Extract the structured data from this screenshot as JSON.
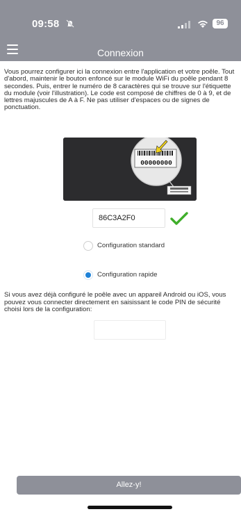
{
  "status_bar": {
    "time": "09:58",
    "battery": "96",
    "icons": [
      "bell-slash-icon",
      "signal-icon",
      "wifi-icon",
      "battery-icon"
    ]
  },
  "nav": {
    "title": "Connexion",
    "menu_icon": "menu-icon"
  },
  "intro_text": "Vous pourrez configurer ici la connexion entre l'application et votre poêle. Tout d'abord, maintenir le bouton enfoncé sur le module WiFi du poêle pendant 8 secondes. Puis, entrer le numéro de 8 caractères qui se trouve sur l'étiquette du module (voir l'illustration). Le code est composé de chiffres de 0 à 9, et de lettres majuscules de A à F. Ne pas utiliser d'espaces ou de signes de ponctuation.",
  "illustration": {
    "label_code": "00000000"
  },
  "code_field": {
    "value": "86C3A2F0",
    "valid_icon": "checkmark-icon"
  },
  "options": [
    {
      "label": "Configuration standard",
      "selected": false
    },
    {
      "label": "Configuration rapide",
      "selected": true
    }
  ],
  "pin_text": "Si vous avez déjà configuré le poêle avec un appareil Android ou iOS, vous pouvez vous connecter directement en saisissant le code PIN de sécurité choisi lors de la configuration:",
  "pin_field": {
    "value": ""
  },
  "submit_label": "Allez-y!",
  "colors": {
    "header": "#8e9099",
    "accent": "#1e82d8",
    "success": "#3fae2a",
    "illustration_bg": "#2c2c2e"
  }
}
